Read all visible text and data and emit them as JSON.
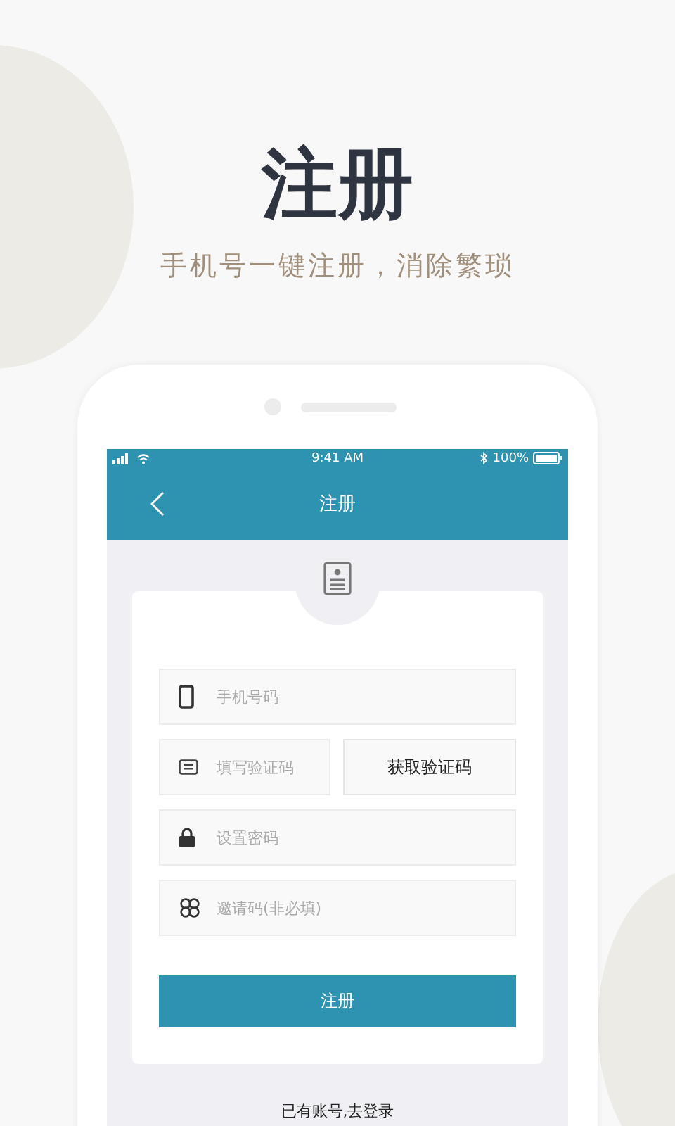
{
  "headline": "注册",
  "subtitle": "手机号一键注册，消除繁琐",
  "status_bar": {
    "time": "9:41 AM",
    "battery": "100%"
  },
  "nav_bar": {
    "title": "注册"
  },
  "fields": [
    {
      "kind": "phone",
      "placeholder": "手机号码"
    },
    {
      "kind": "code",
      "placeholder": "填写验证码",
      "button": "获取验证码"
    },
    {
      "kind": "password",
      "placeholder": "设置密码"
    },
    {
      "kind": "invite",
      "placeholder": "邀请码(非必填)"
    }
  ],
  "submit_button": "注册",
  "login_link": "已有账号,去登录"
}
